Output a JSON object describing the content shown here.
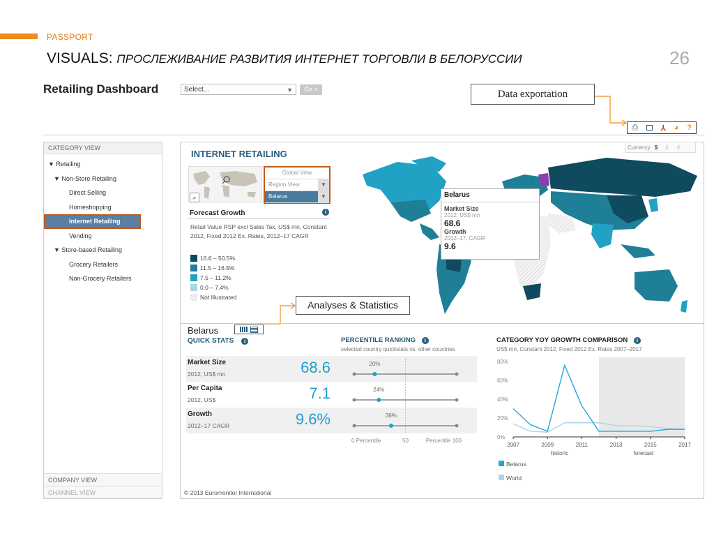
{
  "slide": {
    "section": "PASSPORT",
    "title_prefix": "VISUALS:",
    "title_italic": "ПРОСЛЕЖИВАНИЕ РАЗВИТИЯ ИНТЕРНЕТ ТОРГОВЛИ В БЕЛОРУССИИ",
    "page_number": "26",
    "accent_color": "#f08c1e"
  },
  "header": {
    "title": "Retailing Dashboard",
    "select_value": "Select...",
    "go_label": "Go >"
  },
  "callouts": {
    "data_export": "Data exportation",
    "analyses": "Analyses & Statistics"
  },
  "toolbar": {
    "icons": [
      "print-icon",
      "image-export-icon",
      "pdf-icon",
      "pie-export-icon",
      "help-icon"
    ],
    "help_label": "?"
  },
  "sidebar": {
    "heading": "CATEGORY VIEW",
    "items": [
      {
        "label": "▼ Retailing",
        "level": 1
      },
      {
        "label": "▼ Non-Store Retailing",
        "level": 2
      },
      {
        "label": "Direct Selling",
        "level": 3
      },
      {
        "label": "Homeshopping",
        "level": 3
      },
      {
        "label": "Internet Retailing",
        "level": 3,
        "active": true
      },
      {
        "label": "Vending",
        "level": 3
      },
      {
        "label": "▼ Store-based Retailing",
        "level": 2
      },
      {
        "label": "Grocery Retailers",
        "level": 3
      },
      {
        "label": "Non-Grocery Retailers",
        "level": 3
      }
    ],
    "company_view": "COMPANY VIEW",
    "channel_view": "CHANNEL VIEW"
  },
  "main": {
    "title": "INTERNET RETAILING",
    "currency_label": "Currency",
    "currencies": [
      "$",
      "£",
      "€"
    ],
    "view_options": {
      "global": "Global View",
      "region": "Region View",
      "country": "Belarus"
    },
    "forecast_title": "Forecast Growth",
    "forecast_desc": "Retail Value RSP excl Sales Tax, US$ mn, Constant 2012, Fixed 2012 Ex. Rates, 2012–17 CAGR",
    "legend": [
      {
        "label": "16.6 – 50.5%",
        "color": "#0f4a5e"
      },
      {
        "label": "11.5 – 16.5%",
        "color": "#1f7f96"
      },
      {
        "label": "7.5 – 11.2%",
        "color": "#21a1c4"
      },
      {
        "label": "0.0 – 7.4%",
        "color": "#a9d7e6"
      },
      {
        "label": "Not Illustrated",
        "color": "#e6e6e6"
      }
    ],
    "popup": {
      "country": "Belarus",
      "market_size_label": "Market Size",
      "market_size_sub": "2012, US$ mn",
      "market_size_value": "68.6",
      "growth_label": "Growth",
      "growth_sub": "2012–17, CAGR",
      "growth_value": "9.6"
    },
    "copyright": "© 2013 Euromonitor International"
  },
  "quick_stats": {
    "country": "Belarus",
    "label": "QUICK STATS",
    "rows": [
      {
        "name": "Market Size",
        "sub": "2012, US$ mn",
        "value": "68.6"
      },
      {
        "name": "Per Capita",
        "sub": "2012, US$",
        "value": "7.1"
      },
      {
        "name": "Growth",
        "sub": "2012–17 CAGR",
        "value": "9.6%"
      }
    ]
  },
  "percentile": {
    "title": "PERCENTILE RANKING",
    "subtitle": "selected country quickstats vs. other countries",
    "labels": [
      "20%",
      "24%",
      "36%"
    ],
    "values": [
      20,
      24,
      36
    ],
    "axis": [
      "0 Percentile",
      "50",
      "Percentile 100"
    ]
  },
  "chart_data": {
    "type": "line",
    "title": "CATEGORY YOY GROWTH COMPARISON",
    "subtitle": "US$ mn, Constant 2012, Fixed 2012 Ex. Rates 2007–2017",
    "x": [
      2007,
      2008,
      2009,
      2010,
      2011,
      2012,
      2013,
      2014,
      2015,
      2016,
      2017
    ],
    "x_ticks": [
      "2007",
      "2009",
      "2011",
      "2013",
      "2015",
      "2017"
    ],
    "y_ticks": [
      "80%",
      "60%",
      "40%",
      "20%",
      "0%"
    ],
    "ylim": [
      0,
      80
    ],
    "regions": [
      "historic",
      "forecast"
    ],
    "series": [
      {
        "name": "Belarus",
        "color": "#21a9d6",
        "values": [
          30,
          13,
          6,
          76,
          33,
          6,
          6,
          6,
          6,
          8,
          8
        ]
      },
      {
        "name": "World",
        "color": "#a9d7e6",
        "values": [
          14,
          6,
          5,
          15,
          15,
          15,
          12,
          12,
          11,
          9,
          8
        ]
      }
    ]
  }
}
